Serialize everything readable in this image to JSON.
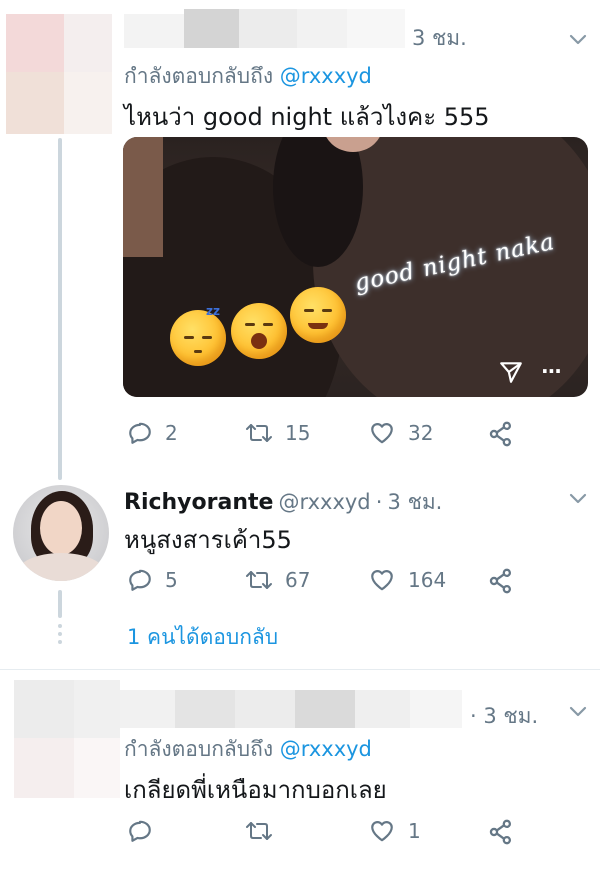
{
  "tweet1": {
    "timestamp": "3 ชม.",
    "replying_prefix": "กำลังตอบกลับถึง",
    "replying_handle": "@rxxxyd",
    "text": "ไหนว่า good night แล้วไงคะ 555",
    "media_caption": "good night naka",
    "media_more": "···",
    "actions": {
      "replies": "2",
      "retweets": "15",
      "likes": "32"
    }
  },
  "tweet2": {
    "name": "Richyorante",
    "handle": "@rxxxyd",
    "separator": "·",
    "timestamp": "3 ชม.",
    "text": "หนูสงสารเค้า55",
    "actions": {
      "replies": "5",
      "retweets": "67",
      "likes": "164"
    },
    "show_replies": "1 คนได้ตอบกลับ"
  },
  "tweet3": {
    "timestamp": "· 3 ชม.",
    "replying_prefix": "กำลังตอบกลับถึง",
    "replying_handle": "@rxxxyd",
    "text": "เกลียดพี่เหนือมากบอกเลย",
    "actions": {
      "replies": "",
      "retweets": "",
      "likes": "1"
    }
  },
  "icons": {
    "reply": "reply-icon",
    "retweet": "retweet-icon",
    "like": "heart-icon",
    "share": "share-icon",
    "more": "chevron-down-icon"
  },
  "colors": {
    "link": "#1b95e0",
    "muted": "#657786",
    "thread_line": "#ccd6dd"
  }
}
